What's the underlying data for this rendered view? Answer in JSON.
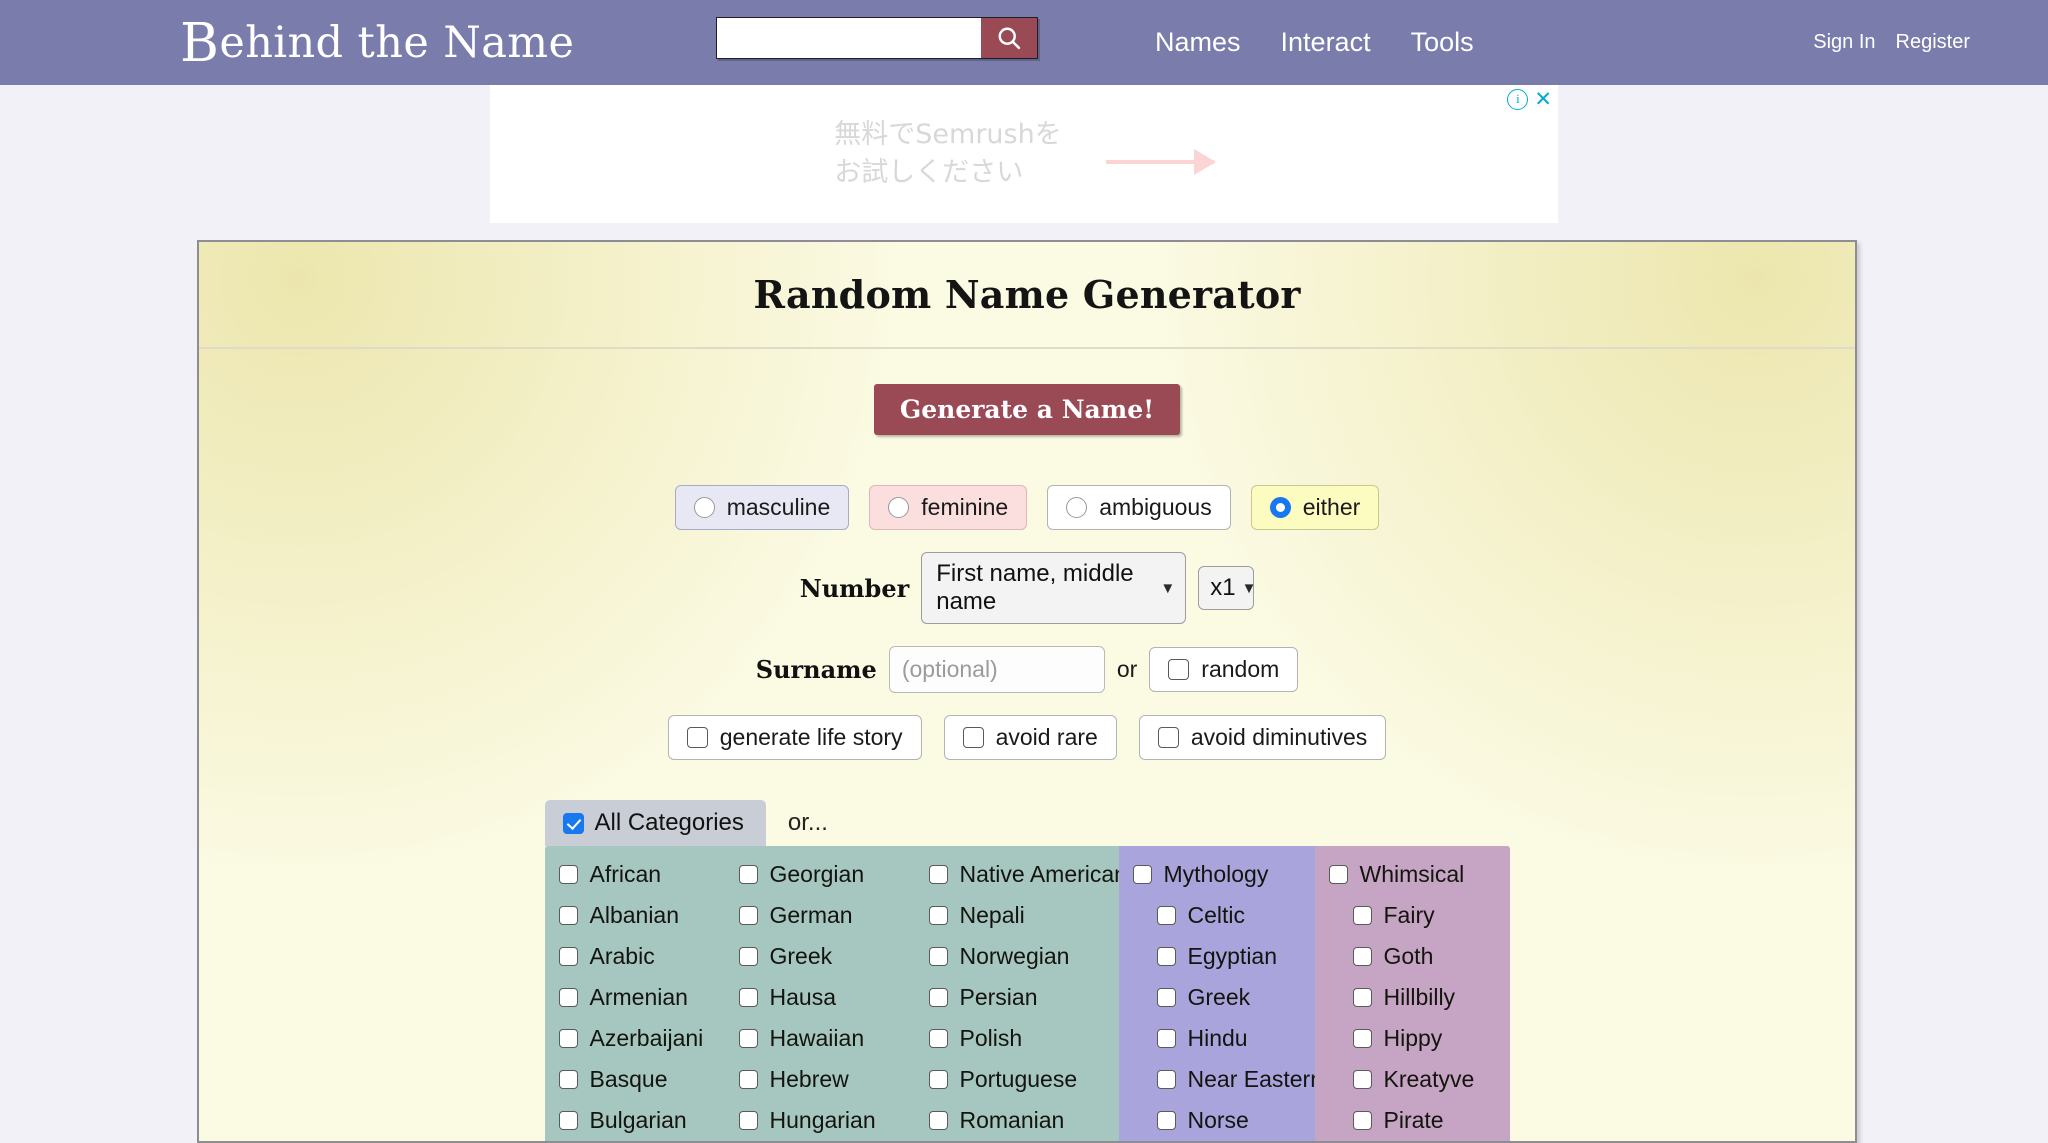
{
  "header": {
    "logo_text": "ehind the Name",
    "logo_dropcap": "B",
    "search_value": "",
    "search_placeholder": "",
    "search_icon": "search-icon",
    "nav": [
      {
        "label": "Names"
      },
      {
        "label": "Interact"
      },
      {
        "label": "Tools"
      }
    ],
    "auth": [
      {
        "label": "Sign In"
      },
      {
        "label": "Register"
      }
    ],
    "bg_color": "#7a7cab",
    "accent_color": "#9a4a54"
  },
  "ad": {
    "text": "無料でSemrushを\nお試しください",
    "arrow": "right-arrow",
    "info_glyph": "i",
    "close_glyph": "✕",
    "link_color": "#00aecd"
  },
  "panel": {
    "title": "Random Name Generator",
    "generate_button": "Generate a Name!"
  },
  "gender": {
    "options": [
      {
        "label": "masculine",
        "selected": false,
        "style": "masc"
      },
      {
        "label": "feminine",
        "selected": false,
        "style": "fem"
      },
      {
        "label": "ambiguous",
        "selected": false,
        "style": "amb"
      },
      {
        "label": "either",
        "selected": true,
        "style": "eit"
      }
    ]
  },
  "number": {
    "label": "Number",
    "type_value": "First name, middle name",
    "multiplier_value": "x1",
    "caret": "▼"
  },
  "surname": {
    "label": "Surname",
    "value": "",
    "placeholder": "(optional)",
    "or_text": "or",
    "random_label": "random",
    "random_checked": false
  },
  "options": [
    {
      "label": "generate life story",
      "checked": false
    },
    {
      "label": "avoid rare",
      "checked": false
    },
    {
      "label": "avoid diminutives",
      "checked": false
    }
  ],
  "categories": {
    "all_label": "All Categories",
    "all_checked": true,
    "or_text": "or...",
    "columns": [
      {
        "kind": "lang",
        "items": [
          {
            "label": "African",
            "checked": false,
            "sub": false
          },
          {
            "label": "Albanian",
            "checked": false,
            "sub": false
          },
          {
            "label": "Arabic",
            "checked": false,
            "sub": false
          },
          {
            "label": "Armenian",
            "checked": false,
            "sub": false
          },
          {
            "label": "Azerbaijani",
            "checked": false,
            "sub": false
          },
          {
            "label": "Basque",
            "checked": false,
            "sub": false
          },
          {
            "label": "Bulgarian",
            "checked": false,
            "sub": false
          }
        ]
      },
      {
        "kind": "lang",
        "items": [
          {
            "label": "Georgian",
            "checked": false,
            "sub": false
          },
          {
            "label": "German",
            "checked": false,
            "sub": false
          },
          {
            "label": "Greek",
            "checked": false,
            "sub": false
          },
          {
            "label": "Hausa",
            "checked": false,
            "sub": false
          },
          {
            "label": "Hawaiian",
            "checked": false,
            "sub": false
          },
          {
            "label": "Hebrew",
            "checked": false,
            "sub": false
          },
          {
            "label": "Hungarian",
            "checked": false,
            "sub": false
          }
        ]
      },
      {
        "kind": "lang",
        "items": [
          {
            "label": "Native American",
            "checked": false,
            "sub": false
          },
          {
            "label": "Nepali",
            "checked": false,
            "sub": false
          },
          {
            "label": "Norwegian",
            "checked": false,
            "sub": false
          },
          {
            "label": "Persian",
            "checked": false,
            "sub": false
          },
          {
            "label": "Polish",
            "checked": false,
            "sub": false
          },
          {
            "label": "Portuguese",
            "checked": false,
            "sub": false
          },
          {
            "label": "Romanian",
            "checked": false,
            "sub": false
          }
        ]
      },
      {
        "kind": "myth",
        "items": [
          {
            "label": "Mythology",
            "checked": false,
            "sub": false
          },
          {
            "label": "Celtic",
            "checked": false,
            "sub": true
          },
          {
            "label": "Egyptian",
            "checked": false,
            "sub": true
          },
          {
            "label": "Greek",
            "checked": false,
            "sub": true
          },
          {
            "label": "Hindu",
            "checked": false,
            "sub": true
          },
          {
            "label": "Near Eastern",
            "checked": false,
            "sub": true
          },
          {
            "label": "Norse",
            "checked": false,
            "sub": true
          }
        ]
      },
      {
        "kind": "whim",
        "items": [
          {
            "label": "Whimsical",
            "checked": false,
            "sub": false
          },
          {
            "label": "Fairy",
            "checked": false,
            "sub": true
          },
          {
            "label": "Goth",
            "checked": false,
            "sub": true
          },
          {
            "label": "Hillbilly",
            "checked": false,
            "sub": true
          },
          {
            "label": "Hippy",
            "checked": false,
            "sub": true
          },
          {
            "label": "Kreatyve",
            "checked": false,
            "sub": true
          },
          {
            "label": "Pirate",
            "checked": false,
            "sub": true
          }
        ]
      }
    ]
  }
}
